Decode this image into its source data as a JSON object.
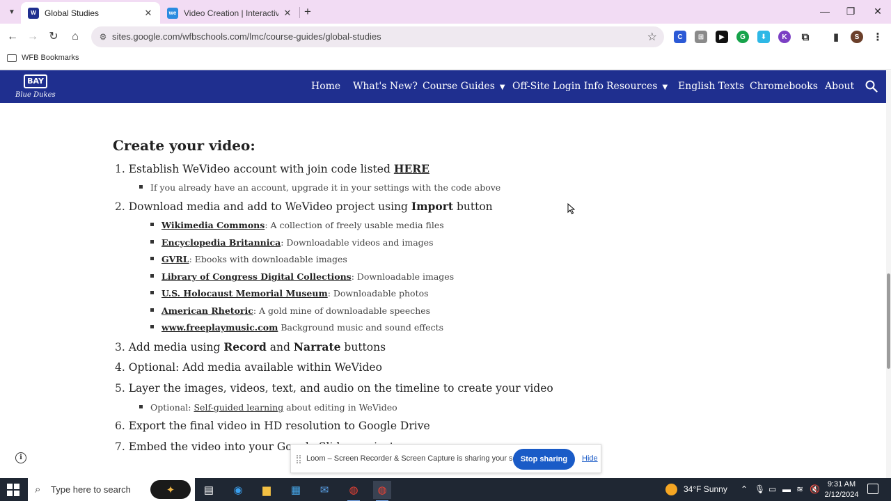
{
  "browser": {
    "tabs": [
      {
        "title": "Global Studies",
        "active": true,
        "close": "✕"
      },
      {
        "title": "Video Creation | Interactive Vid",
        "active": false,
        "close": "✕"
      }
    ],
    "new_tab": "+",
    "window_controls": {
      "minimize": "—",
      "restore": "❐",
      "close": "✕"
    },
    "url": "sites.google.com/wfbschools.com/lmc/course-guides/global-studies",
    "bookmark_folder": "WFB Bookmarks",
    "profile_initial": "S"
  },
  "site": {
    "logo_mark": "BAY",
    "logo_text": "Blue Dukes",
    "nav": [
      {
        "label": "Home"
      },
      {
        "label": "What's New?"
      },
      {
        "label": "Course Guides",
        "dropdown": true
      },
      {
        "label": "Off-Site Login Info"
      },
      {
        "label": "Resources",
        "dropdown": true
      },
      {
        "label": "English Texts"
      },
      {
        "label": "Chromebooks"
      },
      {
        "label": "About"
      }
    ],
    "colors": {
      "header": "#1f2f8f",
      "text": "#222222"
    }
  },
  "content": {
    "heading": "Create your video:",
    "step1": {
      "num": "1.",
      "text": "Establish WeVideo account with join code listed ",
      "link": "HERE"
    },
    "step1_sub": "If you already have an account, upgrade it in your settings with the code above",
    "step2": {
      "num": "2.",
      "pre": "Download media and add to WeVideo project using ",
      "bold": "Import",
      "post": " button"
    },
    "resources": [
      {
        "link": "Wikimedia Commons",
        "desc": ": A collection of freely usable media files"
      },
      {
        "link": "Encyclopedia Britannica",
        "desc": ":  Downloadable videos and images"
      },
      {
        "link": "GVRL",
        "desc": ":  Ebooks with downloadable images"
      },
      {
        "link": "Library of Congress Digital Collections",
        "desc": ": Downloadable images"
      },
      {
        "link": "U.S. Holocaust Memorial Museum",
        "desc": ": Downloadable photos"
      },
      {
        "link": "American Rhetoric",
        "desc": ": A gold mine of downloadable speeches"
      },
      {
        "link": "www.freeplaymusic.com",
        "desc": " Background music and sound effects"
      }
    ],
    "step3": {
      "num": "3.",
      "pre": "Add media using ",
      "bold1": "Record",
      "mid": " and ",
      "bold2": "Narrate",
      "post": " buttons"
    },
    "step4": {
      "num": "4.",
      "text": "Optional: Add media available within WeVideo"
    },
    "step5": {
      "num": "5.",
      "text": "Layer the images, videos, text, and audio on the timeline to create your video"
    },
    "step5_sub": {
      "pre": "Optional: ",
      "link": "Self-guided learning",
      "post": " about editing in WeVideo"
    },
    "step6": {
      "num": "6.",
      "text": "Export the final video in HD resolution to Google Drive"
    },
    "step7": {
      "num": "7.",
      "text": "Embed the video into your Google Slides project"
    }
  },
  "loom": {
    "message": "Loom – Screen Recorder & Screen Capture is sharing your screen.",
    "stop_label": "Stop sharing",
    "hide_label": "Hide"
  },
  "taskbar": {
    "search_placeholder": "Type here to search",
    "weather": "34°F  Sunny",
    "time": "9:31 AM",
    "date": "2/12/2024"
  }
}
